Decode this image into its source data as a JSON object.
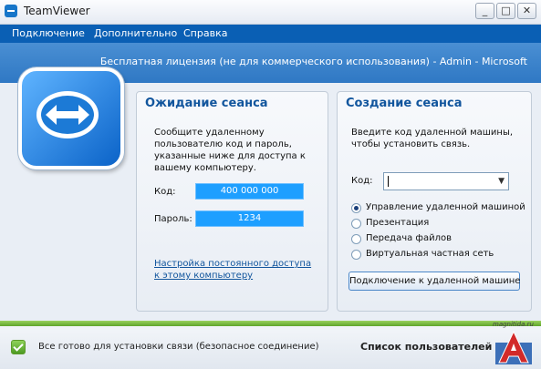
{
  "window": {
    "title": "TeamViewer"
  },
  "menu": {
    "items": [
      "Подключение",
      "Дополнительно",
      "Справка"
    ]
  },
  "header": {
    "license": "Бесплатная лицензия (не для коммерческого использования) - Admin - Microsoft"
  },
  "waiting": {
    "title": "Ожидание сеанса",
    "description": [
      "Сообщите удаленному",
      "пользователю код и пароль,",
      "указанные ниже для доступа к",
      "вашему компьютеру."
    ],
    "id_label": "Код:",
    "id_value": "400 000 000",
    "password_label": "Пароль:",
    "password_value": "1234",
    "link": [
      "Настройка постоянного доступа",
      "к этому компьютеру"
    ]
  },
  "create": {
    "title": "Создание сеанса",
    "description": [
      "Введите код удаленной машины,",
      "чтобы установить связь."
    ],
    "id_label": "Код:",
    "id_value": "",
    "options": [
      {
        "label": "Управление удаленной машиной",
        "checked": true
      },
      {
        "label": "Презентация",
        "checked": false
      },
      {
        "label": "Передача файлов",
        "checked": false
      },
      {
        "label": "Виртуальная частная сеть",
        "checked": false
      }
    ],
    "connect_button": "Подключение к удаленной машине"
  },
  "status": {
    "text": "Все готово для установки связи (безопасное соединение)",
    "partners_label": "Список пользователей"
  },
  "watermark": {
    "text": "magnitida.ru"
  },
  "colors": {
    "menu": "#0a5fb4",
    "header": "#3a82cb",
    "accent": "#1e9fff",
    "green": "#6cb335"
  }
}
